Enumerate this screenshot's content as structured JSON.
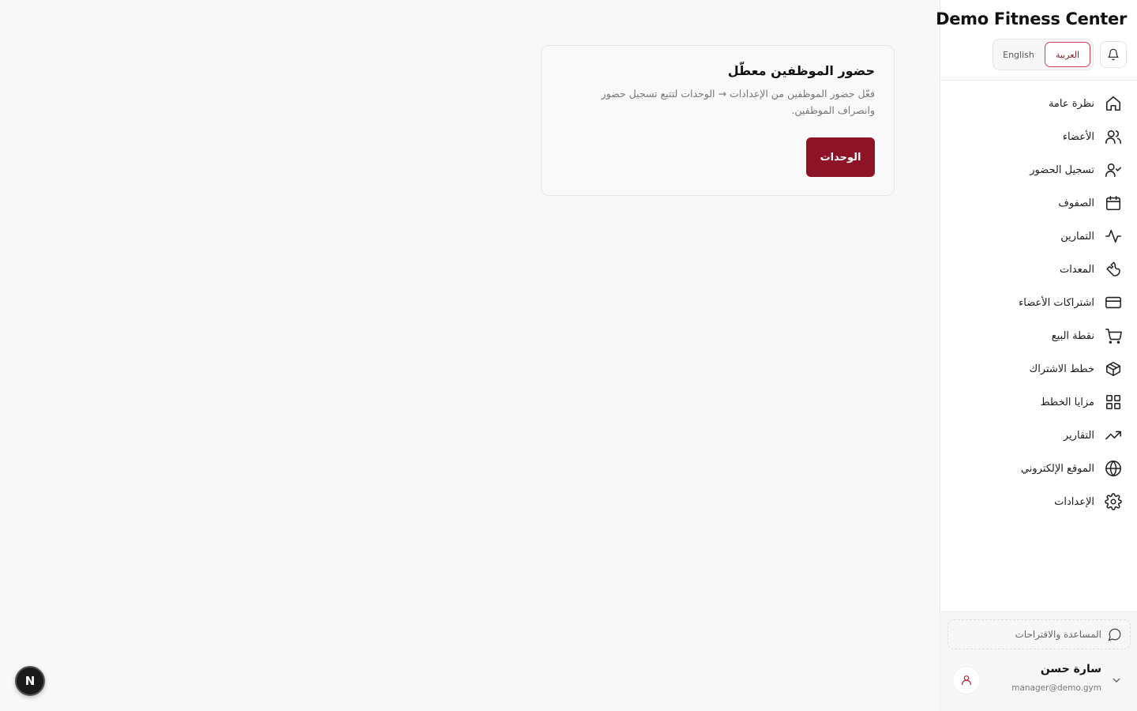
{
  "brand": {
    "name": "Demo Fitness Center"
  },
  "language": {
    "arabic_label": "العربية",
    "english_label": "English",
    "selected": "العربية"
  },
  "nav": {
    "items": [
      {
        "label": "نظرة عامة",
        "icon": "home-icon"
      },
      {
        "label": "الأعضاء",
        "icon": "users-icon"
      },
      {
        "label": "تسجيل الحضور",
        "icon": "user-check-icon"
      },
      {
        "label": "الصفوف",
        "icon": "calendar-icon"
      },
      {
        "label": "التمارين",
        "icon": "activity-icon"
      },
      {
        "label": "المعدات",
        "icon": "wrench-icon"
      },
      {
        "label": "اشتراكات الأعضاء",
        "icon": "credit-card-icon"
      },
      {
        "label": "نقطة البيع",
        "icon": "cart-icon"
      },
      {
        "label": "خطط الاشتراك",
        "icon": "package-icon"
      },
      {
        "label": "مزايا الخطط",
        "icon": "grid-icon"
      },
      {
        "label": "التقارير",
        "icon": "trending-up-icon"
      },
      {
        "label": "الموقع الإلكتروني",
        "icon": "globe-icon"
      },
      {
        "label": "الإعدادات",
        "icon": "gear-icon"
      }
    ]
  },
  "footer": {
    "help_label": "المساعدة والاقتراحات",
    "user_name": "سارة حسن",
    "user_email": "manager@demo.gym"
  },
  "card": {
    "title": "حضور الموظفين معطّل",
    "description": "فعّل حضور الموظفين من الإعدادات → الوحدات لتتبع تسجيل حضور وانصراف الموظفين.",
    "button_label": "الوحدات"
  },
  "badge": {
    "letter": "N"
  },
  "colors": {
    "accent": "#8d1426",
    "accent_border": "#c7434f"
  }
}
